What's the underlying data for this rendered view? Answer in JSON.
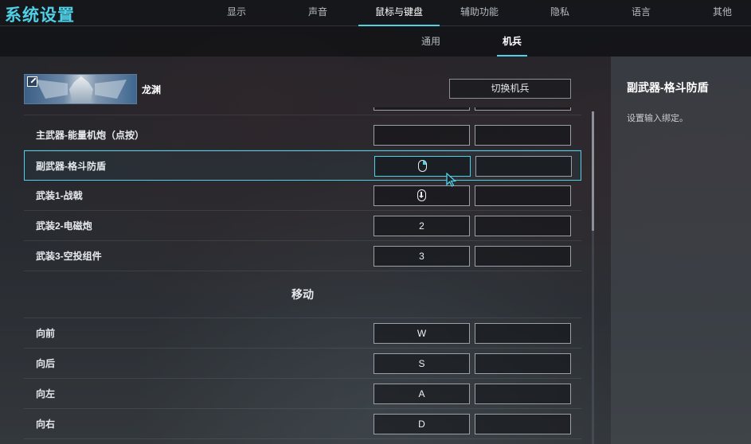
{
  "app_title": "系统设置",
  "main_tabs": [
    {
      "label": "显示"
    },
    {
      "label": "声音"
    },
    {
      "label": "鼠标与键盘",
      "active": true
    },
    {
      "label": "辅助功能"
    },
    {
      "label": "隐私"
    },
    {
      "label": "语言"
    },
    {
      "label": "其他"
    }
  ],
  "sub_tabs": [
    {
      "label": "通用"
    },
    {
      "label": "机兵",
      "active": true
    }
  ],
  "mech": {
    "name": "龙渊",
    "switch_label": "切换机兵"
  },
  "bindings": [
    {
      "label": "主武器-能量机炮（点按）",
      "key1": "",
      "key2": ""
    },
    {
      "label": "副武器-格斗防盾",
      "key1_icon": "mouse-right-click-icon",
      "key2": "",
      "selected": true
    },
    {
      "label": "武装1-战戟",
      "key1_icon": "mouse-wheel-icon",
      "key2": ""
    },
    {
      "label": "武装2-电磁炮",
      "key1": "2",
      "key2": ""
    },
    {
      "label": "武装3-空投组件",
      "key1": "3",
      "key2": ""
    }
  ],
  "movement": {
    "title": "移动",
    "bindings": [
      {
        "label": "向前",
        "key1": "W",
        "key2": ""
      },
      {
        "label": "向后",
        "key1": "S",
        "key2": ""
      },
      {
        "label": "向左",
        "key1": "A",
        "key2": ""
      },
      {
        "label": "向右",
        "key1": "D",
        "key2": ""
      }
    ]
  },
  "detail": {
    "title": "副武器-格斗防盾",
    "description": "设置输入绑定。"
  },
  "colors": {
    "accent": "#4fd0e6",
    "panel_bg": "#20232a",
    "text": "#e6eaee"
  }
}
